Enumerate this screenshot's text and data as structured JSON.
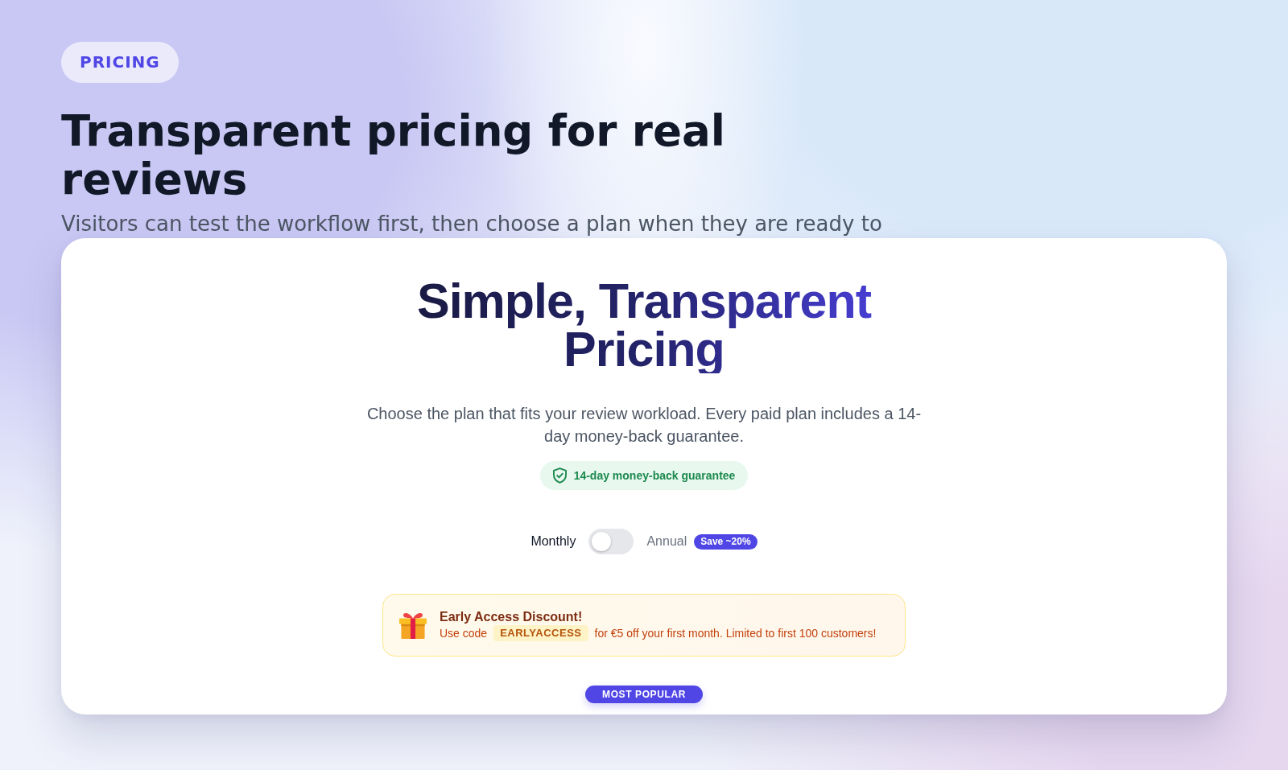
{
  "eyebrow": {
    "label": "PRICING"
  },
  "hero": {
    "title": "Transparent pricing for real reviews",
    "subtitle": "Visitors can test the workflow first, then choose a plan when they are ready to"
  },
  "pricing_card": {
    "title": "Simple, Transparent Pricing",
    "description": "Choose the plan that fits your review workload. Every paid plan includes a 14-day money-back guarantee.",
    "guarantee_badge": "14-day money-back guarantee",
    "billing_toggle": {
      "options": [
        {
          "label": "Monthly",
          "selected": true
        },
        {
          "label": "Annual",
          "selected": false
        }
      ],
      "on": false,
      "save_badge": "Save ~20%"
    },
    "discount": {
      "title": "Early Access Discount!",
      "text_before": "Use code",
      "code": "EARLYACCESS",
      "text_after": "for €5 off your first month. Limited to first 100 customers!"
    },
    "featured_badge": "MOST POPULAR"
  }
}
